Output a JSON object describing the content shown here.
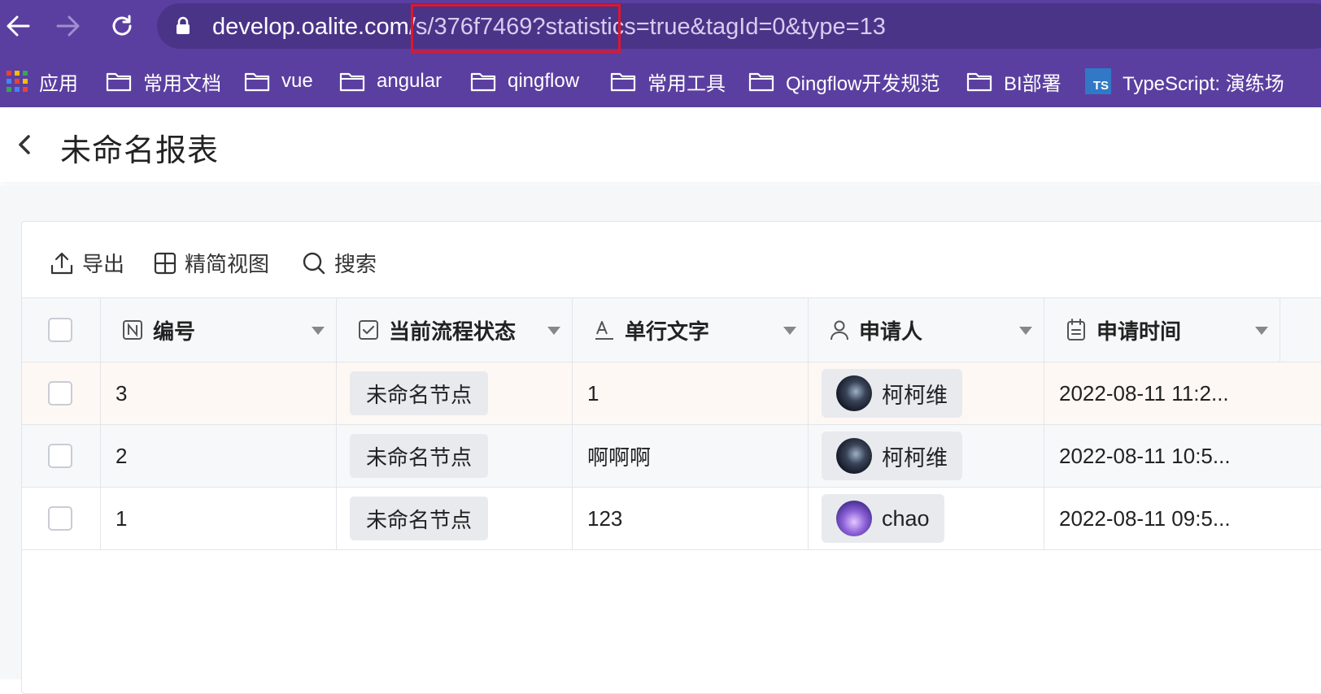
{
  "browser": {
    "url_host": "develop.oalite.com",
    "url_rest": "/s/376f7469?statistics=true&tagId=0&type=13",
    "bookmarks": [
      {
        "label": "应用",
        "icon": "apps-grid-icon"
      },
      {
        "label": "常用文档",
        "icon": "folder-icon"
      },
      {
        "label": "vue",
        "icon": "folder-icon"
      },
      {
        "label": "angular",
        "icon": "folder-icon"
      },
      {
        "label": "qingflow",
        "icon": "folder-icon"
      },
      {
        "label": "常用工具",
        "icon": "folder-icon"
      },
      {
        "label": "Qingflow开发规范",
        "icon": "folder-icon"
      },
      {
        "label": "BI部署",
        "icon": "folder-icon"
      },
      {
        "label": "TypeScript: 演练场",
        "icon": "typescript-icon"
      }
    ],
    "typescript_badge": "TS"
  },
  "page": {
    "title": "未命名报表"
  },
  "toolbar": {
    "export": "导出",
    "compact_view": "精简视图",
    "search": "搜索"
  },
  "table": {
    "columns": [
      {
        "label": "编号",
        "icon": "number-field-icon"
      },
      {
        "label": "当前流程状态",
        "icon": "checkbox-status-icon"
      },
      {
        "label": "单行文字",
        "icon": "text-field-icon"
      },
      {
        "label": "申请人",
        "icon": "user-icon"
      },
      {
        "label": "申请时间",
        "icon": "calendar-icon"
      }
    ],
    "rows": [
      {
        "id": "3",
        "status": "未命名节点",
        "text": "1",
        "applicant": "柯柯维",
        "time": "2022-08-11 11:2...",
        "highlight": true
      },
      {
        "id": "2",
        "status": "未命名节点",
        "text": "啊啊啊",
        "applicant": "柯柯维",
        "time": "2022-08-11 10:5...",
        "highlight": false
      },
      {
        "id": "1",
        "status": "未命名节点",
        "text": "123",
        "applicant": "chao",
        "time": "2022-08-11 09:5...",
        "highlight": false
      }
    ]
  },
  "colors": {
    "browser_bar": "#5b3fa0",
    "address_bar": "#4a3488",
    "highlight_row": "#fdf8f4",
    "alt_row": "#f7f8fa",
    "annotation_red": "#e0162b"
  }
}
